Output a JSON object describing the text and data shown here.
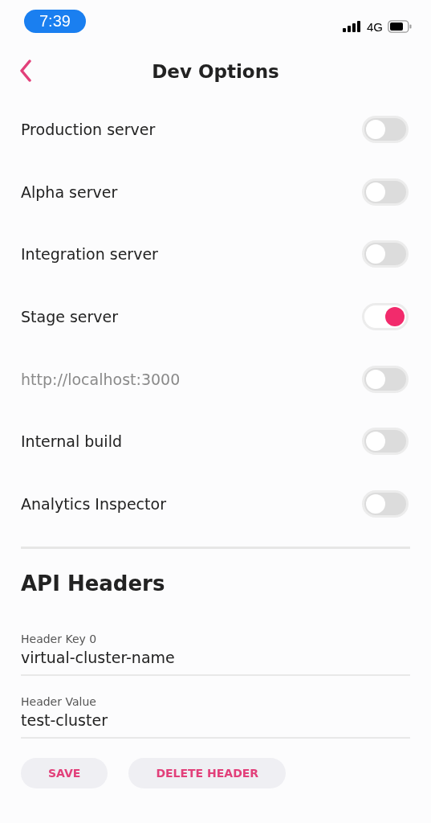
{
  "status_bar": {
    "time": "7:39",
    "network": "4G"
  },
  "header": {
    "title": "Dev Options"
  },
  "options": [
    {
      "label": "Production server",
      "on": false,
      "disabled": false
    },
    {
      "label": "Alpha server",
      "on": false,
      "disabled": false
    },
    {
      "label": "Integration server",
      "on": false,
      "disabled": false
    },
    {
      "label": "Stage server",
      "on": true,
      "disabled": false
    },
    {
      "label": "http://localhost:3000",
      "on": false,
      "disabled": true
    },
    {
      "label": "Internal build",
      "on": false,
      "disabled": false
    },
    {
      "label": "Analytics Inspector",
      "on": false,
      "disabled": false
    }
  ],
  "api_headers": {
    "title": "API Headers",
    "fields": [
      {
        "label": "Header Key 0",
        "value": "virtual-cluster-name"
      },
      {
        "label": "Header Value",
        "value": "test-cluster"
      }
    ],
    "buttons": [
      "SAVE",
      "DELETE HEADER"
    ]
  }
}
